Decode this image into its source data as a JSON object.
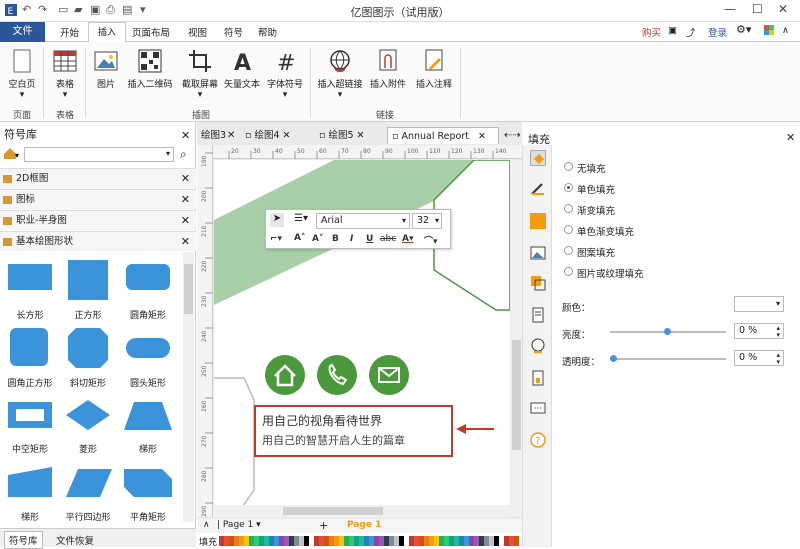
{
  "app": {
    "title": "亿图图示（试用版）"
  },
  "titlebar": {
    "buy": "购买",
    "login": "登录"
  },
  "menu": {
    "file": "文件",
    "tabs": [
      "开始",
      "插入",
      "页面布局",
      "视图",
      "符号",
      "帮助"
    ]
  },
  "ribbon": {
    "buttons": [
      "空白页",
      "表格",
      "图片",
      "插入二维码",
      "截取屏幕",
      "矢量文本",
      "字体符号",
      "插入超链接",
      "插入附件",
      "插入注释"
    ],
    "groups": [
      "页面",
      "表格",
      "插图",
      "链接"
    ]
  },
  "left": {
    "title": "符号库",
    "libs": [
      "2D框图",
      "图标",
      "职业-半身图",
      "基本绘图形状"
    ],
    "shapes": [
      "长方形",
      "正方形",
      "圆角矩形",
      "圆角正方形",
      "斜切矩形",
      "圆头矩形",
      "中空矩形",
      "菱形",
      "梯形",
      "梯形",
      "平行四边形",
      "平角矩形"
    ],
    "bottom_tabs": [
      "符号库",
      "文件恢复"
    ]
  },
  "doc_tabs": [
    "绘图3",
    "绘图4",
    "绘图5",
    "Annual Report"
  ],
  "ruler": {
    "top": [
      "20",
      "30",
      "40",
      "50",
      "60",
      "70",
      "80",
      "90",
      "100",
      "110",
      "120",
      "130",
      "140"
    ],
    "left": [
      "190",
      "200",
      "210",
      "220",
      "230",
      "240",
      "250",
      "260",
      "270",
      "280",
      "290"
    ]
  },
  "toolbar": {
    "font": "Arial",
    "size": "32"
  },
  "textbox": {
    "line1": "用自己的视角看待世界",
    "line2": "用自己的智慧开启人生的篇章"
  },
  "pagebar": {
    "page_sel": "Page 1",
    "page_tab": "Page 1",
    "color_label": "填充"
  },
  "right": {
    "title": "填充",
    "fill_options": [
      "无填充",
      "单色填充",
      "渐变填充",
      "单色渐变填充",
      "图案填充",
      "图片或纹理填充"
    ],
    "selected": 1,
    "props": [
      {
        "label": "颜色：",
        "value": ""
      },
      {
        "label": "亮度：",
        "value": "0 %"
      },
      {
        "label": "透明度：",
        "value": "0 %"
      }
    ]
  },
  "colors": {
    "accent": "#2b579a",
    "green": "#4a9a3b",
    "pale_green": "#a8cfa8",
    "red": "#c0392b",
    "shape_blue": "#3b93d9",
    "orange": "#f39c12"
  }
}
